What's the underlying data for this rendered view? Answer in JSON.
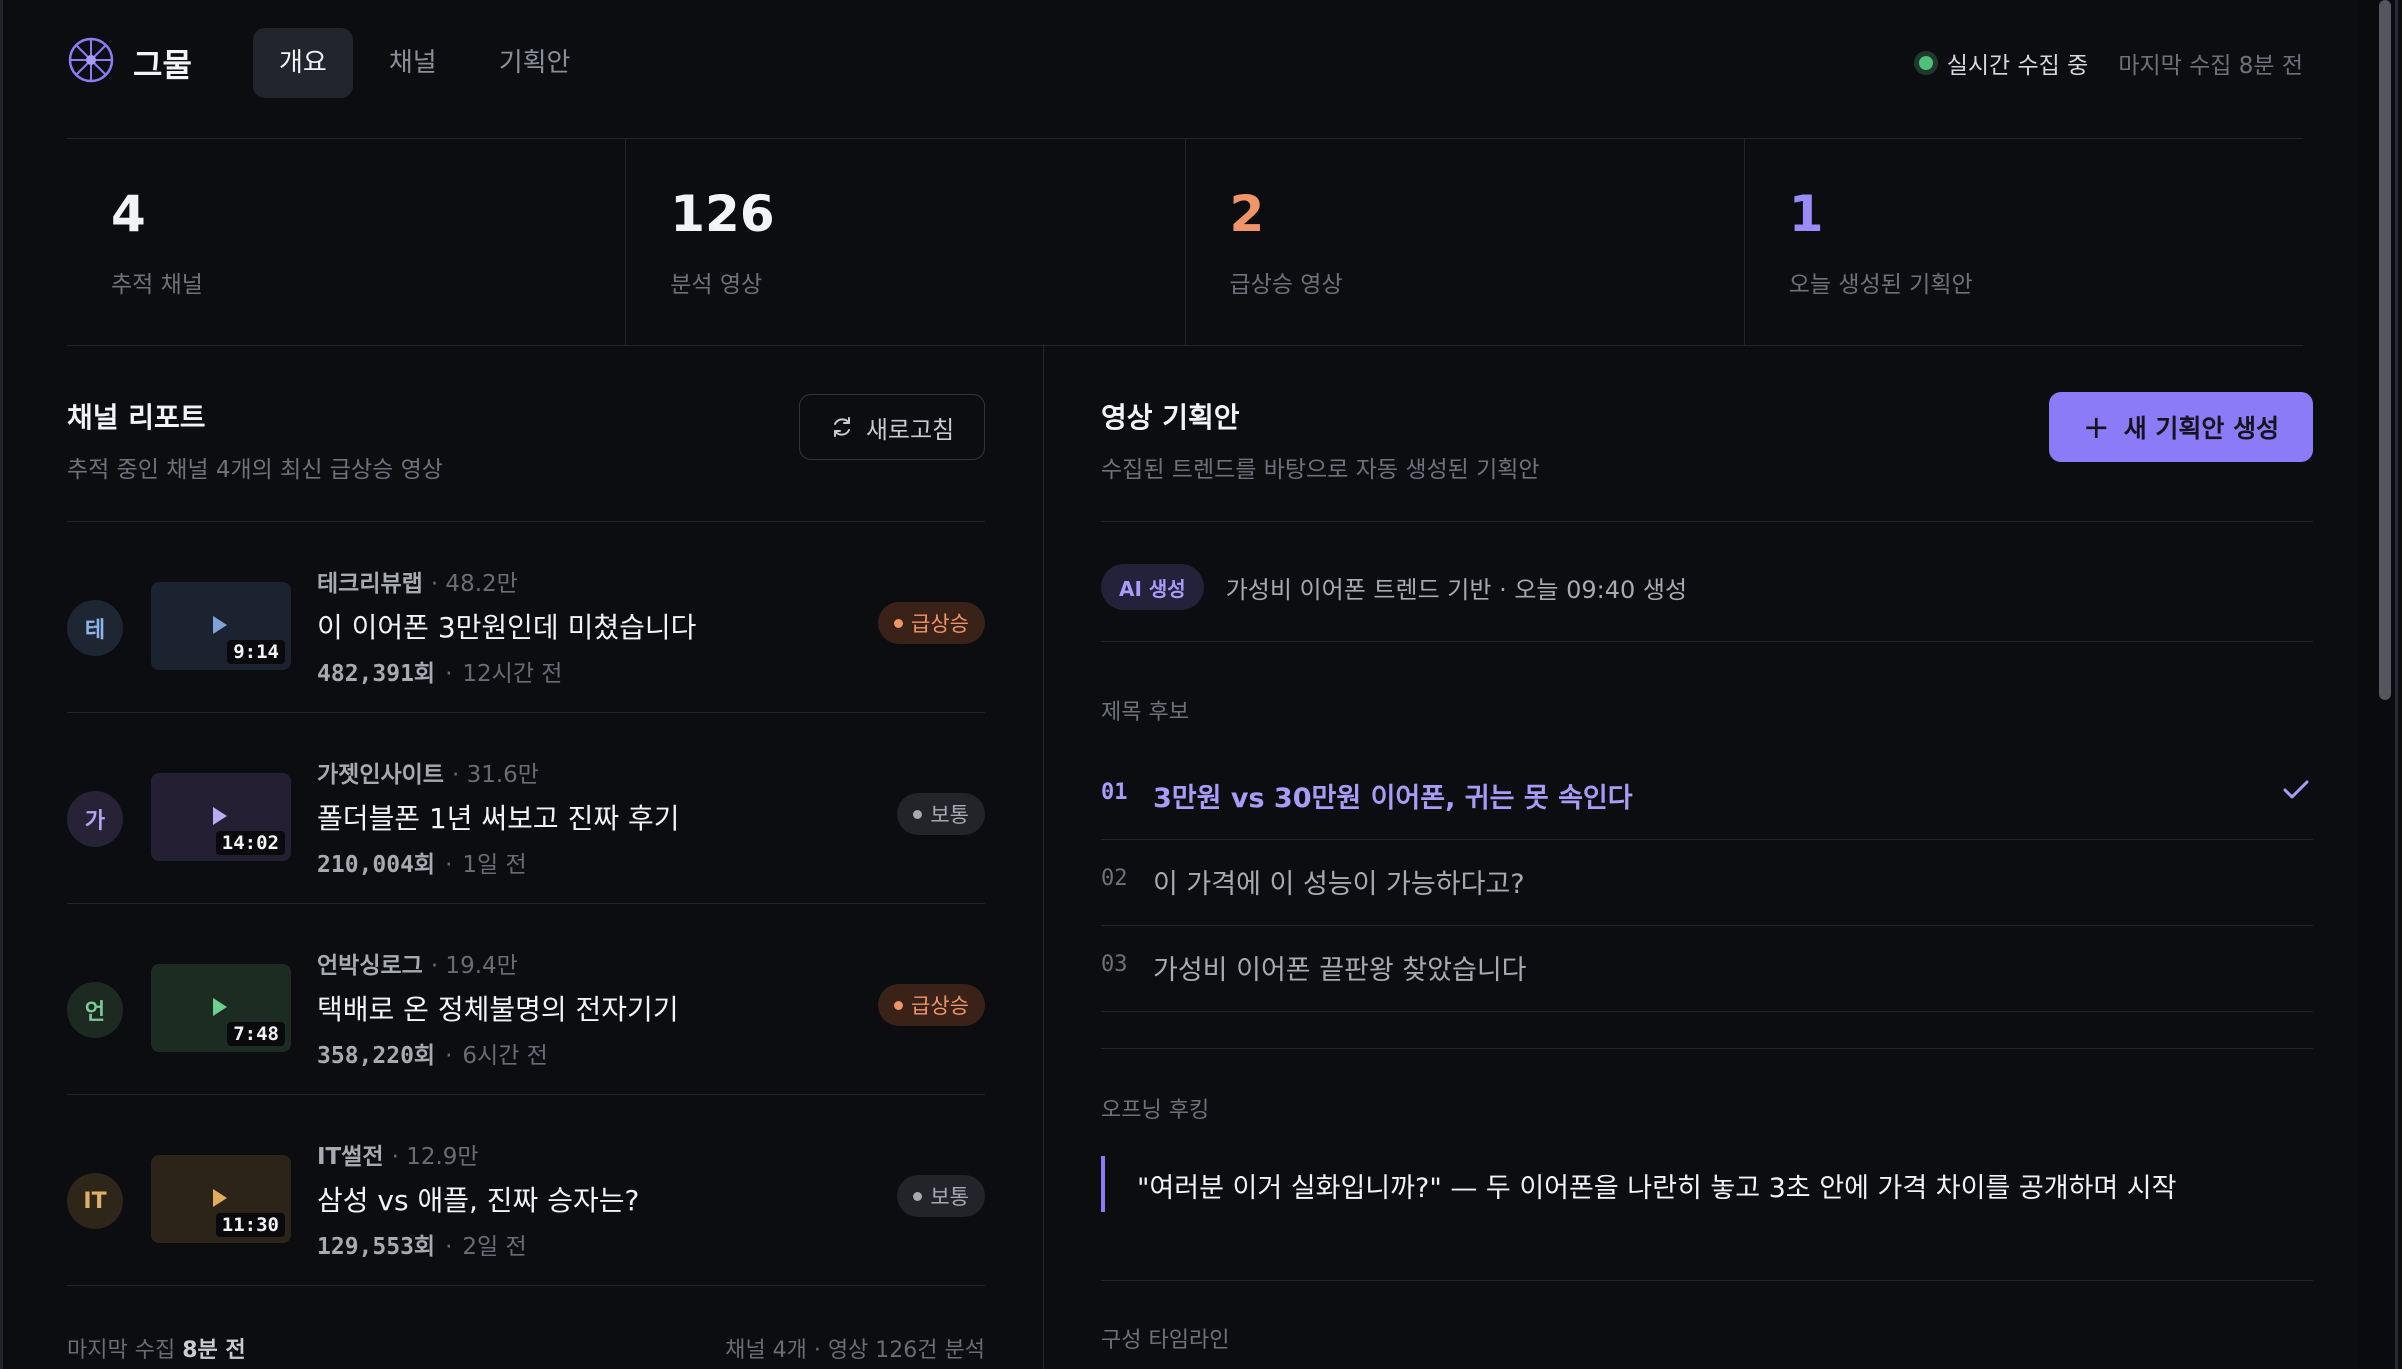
{
  "app": {
    "brand": "그물"
  },
  "nav": {
    "tabs": [
      "개요",
      "채널",
      "기획안"
    ],
    "active": 0
  },
  "status": {
    "live": "실시간 수집 중",
    "last": "마지막 수집 8분 전"
  },
  "stats": [
    {
      "value": "4",
      "label": "추적 채널",
      "color": "#f2f3f6"
    },
    {
      "value": "126",
      "label": "분석 영상",
      "color": "#f2f3f6"
    },
    {
      "value": "2",
      "label": "급상승 영상",
      "color": "#f0956a"
    },
    {
      "value": "1",
      "label": "오늘 생성된 기획안",
      "color": "#9a8cf7"
    }
  ],
  "report": {
    "title": "채널 리포트",
    "subtitle": "추적 중인 채널 4개의 최신 급상승 영상",
    "refresh": "새로고침",
    "videos": [
      {
        "avatar": "테",
        "avatar_bg": "#1e2633",
        "avatar_fg": "#8fb4e8",
        "thumb_bg": "#1b2230",
        "play": "#7fa2d8",
        "duration": "9:14",
        "channel": "테크리뷰랩",
        "subs": "· 48.2만",
        "title": "이 이어폰 3만원인데 미쳤습니다",
        "views": "482,391회",
        "sep": "·",
        "time": "12시간 전",
        "badge": "급상승",
        "badge_type": "hot"
      },
      {
        "avatar": "가",
        "avatar_bg": "#272236",
        "avatar_fg": "#b3a5ee",
        "thumb_bg": "#241f33",
        "play": "#b8acf0",
        "duration": "14:02",
        "channel": "가젯인사이트",
        "subs": "· 31.6만",
        "title": "폴더블폰 1년 써보고 진짜 후기",
        "views": "210,004회",
        "sep": "·",
        "time": "1일 전",
        "badge": "보통",
        "badge_type": "normal"
      },
      {
        "avatar": "언",
        "avatar_bg": "#1c2a22",
        "avatar_fg": "#7dc99a",
        "thumb_bg": "#1c2c22",
        "play": "#6fcf8f",
        "duration": "7:48",
        "channel": "언박싱로그",
        "subs": "· 19.4만",
        "title": "택배로 온 정체불명의 전자기기",
        "views": "358,220회",
        "sep": "·",
        "time": "6시간 전",
        "badge": "급상승",
        "badge_type": "hot"
      },
      {
        "avatar": "IT",
        "avatar_bg": "#2e2619",
        "avatar_fg": "#e2b064",
        "thumb_bg": "#2c2418",
        "play": "#e0ad5e",
        "duration": "11:30",
        "channel": "IT썰전",
        "subs": "· 12.9만",
        "title": "삼성 vs 애플, 진짜 승자는?",
        "views": "129,553회",
        "sep": "·",
        "time": "2일 전",
        "badge": "보통",
        "badge_type": "normal"
      }
    ],
    "footer_prefix": "마지막 수집",
    "footer_strong": "8분 전",
    "footer_right": "채널 4개 · 영상 126건 분석"
  },
  "plan": {
    "title": "영상 기획안",
    "subtitle": "수집된 트렌드를 바탕으로 자동 생성된 기획안",
    "new_button": "새 기획안 생성",
    "ai_badge": "AI 생성",
    "ai_meta": "가성비 이어폰 트렌드 기반 · 오늘 09:40 생성",
    "candidates_label": "제목 후보",
    "candidates": [
      {
        "num": "01",
        "text": "3만원 vs 30만원 이어폰, 귀는 못 속인다",
        "selected": true
      },
      {
        "num": "02",
        "text": "이 가격에 이 성능이 가능하다고?",
        "selected": false
      },
      {
        "num": "03",
        "text": "가성비 이어폰 끝판왕 찾았습니다",
        "selected": false
      }
    ],
    "hook_label": "오프닝 후킹",
    "hook_text": "\"여러분 이거 실화입니까?\" — 두 이어폰을 나란히 놓고 3초 안에 가격 차이를 공개하며 시작",
    "timeline_label": "구성 타임라인"
  },
  "colors": {
    "accent": "#8b7bf6",
    "hot": "#f0956a",
    "live": "#4fbf7a",
    "background": "#0c0d11"
  },
  "icons": {
    "logo": "network-logo-icon",
    "refresh": "refresh-icon",
    "plus": "plus-icon",
    "check": "check-icon",
    "play": "play-icon"
  }
}
